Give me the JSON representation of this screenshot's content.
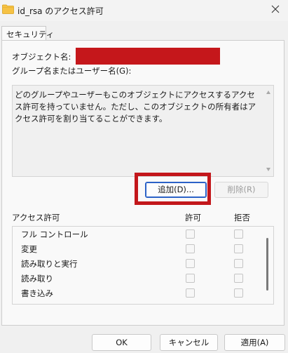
{
  "window": {
    "title": "id_rsa のアクセス許可"
  },
  "tabs": [
    {
      "label": "セキュリティ"
    }
  ],
  "security": {
    "object_name_label": "オブジェクト名:",
    "group_user_label": "グループ名またはユーザー名(G):",
    "message": "どのグループやユーザーもこのオブジェクトにアクセスするアクセス許可を持っていません。ただし、このオブジェクトの所有者はアクセス許可を割り当てることができます。",
    "add_button": "追加(D)...",
    "remove_button": "削除(R)"
  },
  "permissions": {
    "header": "アクセス許可",
    "allow_header": "許可",
    "deny_header": "拒否",
    "items": [
      {
        "name": "フル コントロール",
        "allow": false,
        "deny": false
      },
      {
        "name": "変更",
        "allow": false,
        "deny": false
      },
      {
        "name": "読み取りと実行",
        "allow": false,
        "deny": false
      },
      {
        "name": "読み取り",
        "allow": false,
        "deny": false
      },
      {
        "name": "書き込み",
        "allow": false,
        "deny": false
      }
    ]
  },
  "footer": {
    "ok": "OK",
    "cancel": "キャンセル",
    "apply": "適用(A)"
  },
  "colors": {
    "redaction": "#c5171b",
    "accent_border": "#2b62c7",
    "folder": "#f6c244"
  },
  "icons": {
    "title": "folder-icon",
    "close": "close-icon"
  }
}
